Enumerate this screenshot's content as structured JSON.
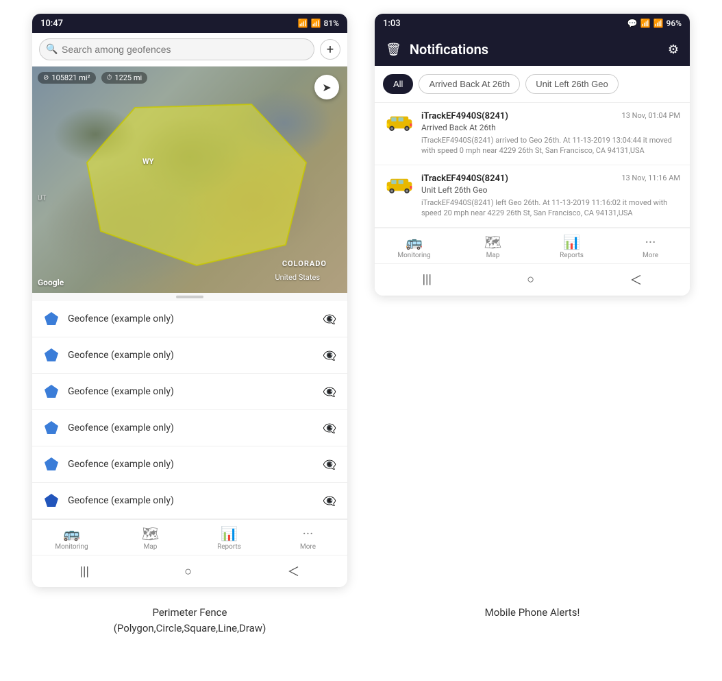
{
  "left_phone": {
    "status_bar": {
      "time": "10:47",
      "wifi": "WiFi",
      "signal": "4G",
      "battery": "81%"
    },
    "search": {
      "placeholder": "Search among geofences"
    },
    "map": {
      "area": "105821 mi²",
      "distance": "1225 mi",
      "wy_label": "WY",
      "ut_label": "UT",
      "state_label": "COLORADO",
      "us_label": "United States",
      "google_label": "Google"
    },
    "geofences": [
      {
        "name": "Geofence (example only)"
      },
      {
        "name": "Geofence (example only)"
      },
      {
        "name": "Geofence (example only)"
      },
      {
        "name": "Geofence (example only)"
      },
      {
        "name": "Geofence (example only)"
      },
      {
        "name": "Geofence (example only)"
      }
    ],
    "nav": [
      {
        "label": "Monitoring",
        "icon": "🚌"
      },
      {
        "label": "Map",
        "icon": "🗺"
      },
      {
        "label": "Reports",
        "icon": "📊"
      },
      {
        "label": "More",
        "icon": "···"
      }
    ],
    "android_nav": [
      "|||",
      "○",
      "<"
    ]
  },
  "right_phone": {
    "status_bar": {
      "time": "1:03",
      "chat": "💬",
      "wifi": "WiFi",
      "signal": "4G",
      "battery": "96%"
    },
    "header": {
      "title": "Notifications",
      "delete_icon": "🗑",
      "settings_icon": "⚙"
    },
    "filters": [
      {
        "label": "All",
        "active": true
      },
      {
        "label": "Arrived Back At 26th",
        "active": false
      },
      {
        "label": "Unit Left 26th Geo",
        "active": false
      }
    ],
    "notifications": [
      {
        "device": "iTrackEF4940S(8241)",
        "time": "13 Nov, 01:04 PM",
        "subtitle": "Arrived Back At 26th",
        "body": "iTrackEF4940S(8241) arrived to Geo 26th.    At 11-13-2019 13:04:44 it moved with speed 0 mph near 4229 26th St, San Francisco, CA 94131,USA"
      },
      {
        "device": "iTrackEF4940S(8241)",
        "time": "13 Nov, 11:16 AM",
        "subtitle": "Unit Left 26th Geo",
        "body": "iTrackEF4940S(8241) left Geo 26th.   At 11-13-2019 11:16:02 it moved with speed 20 mph near 4229 26th St, San Francisco, CA 94131,USA"
      }
    ],
    "nav": [
      {
        "label": "Monitoring",
        "icon": "🚌"
      },
      {
        "label": "Map",
        "icon": "🗺"
      },
      {
        "label": "Reports",
        "icon": "📊"
      },
      {
        "label": "More",
        "icon": "···"
      }
    ],
    "android_nav": [
      "|||",
      "○",
      "<"
    ]
  },
  "captions": {
    "left": "Perimeter Fence\n(Polygon,Circle,Square,Line,Draw)",
    "right": "Mobile Phone Alerts!"
  }
}
